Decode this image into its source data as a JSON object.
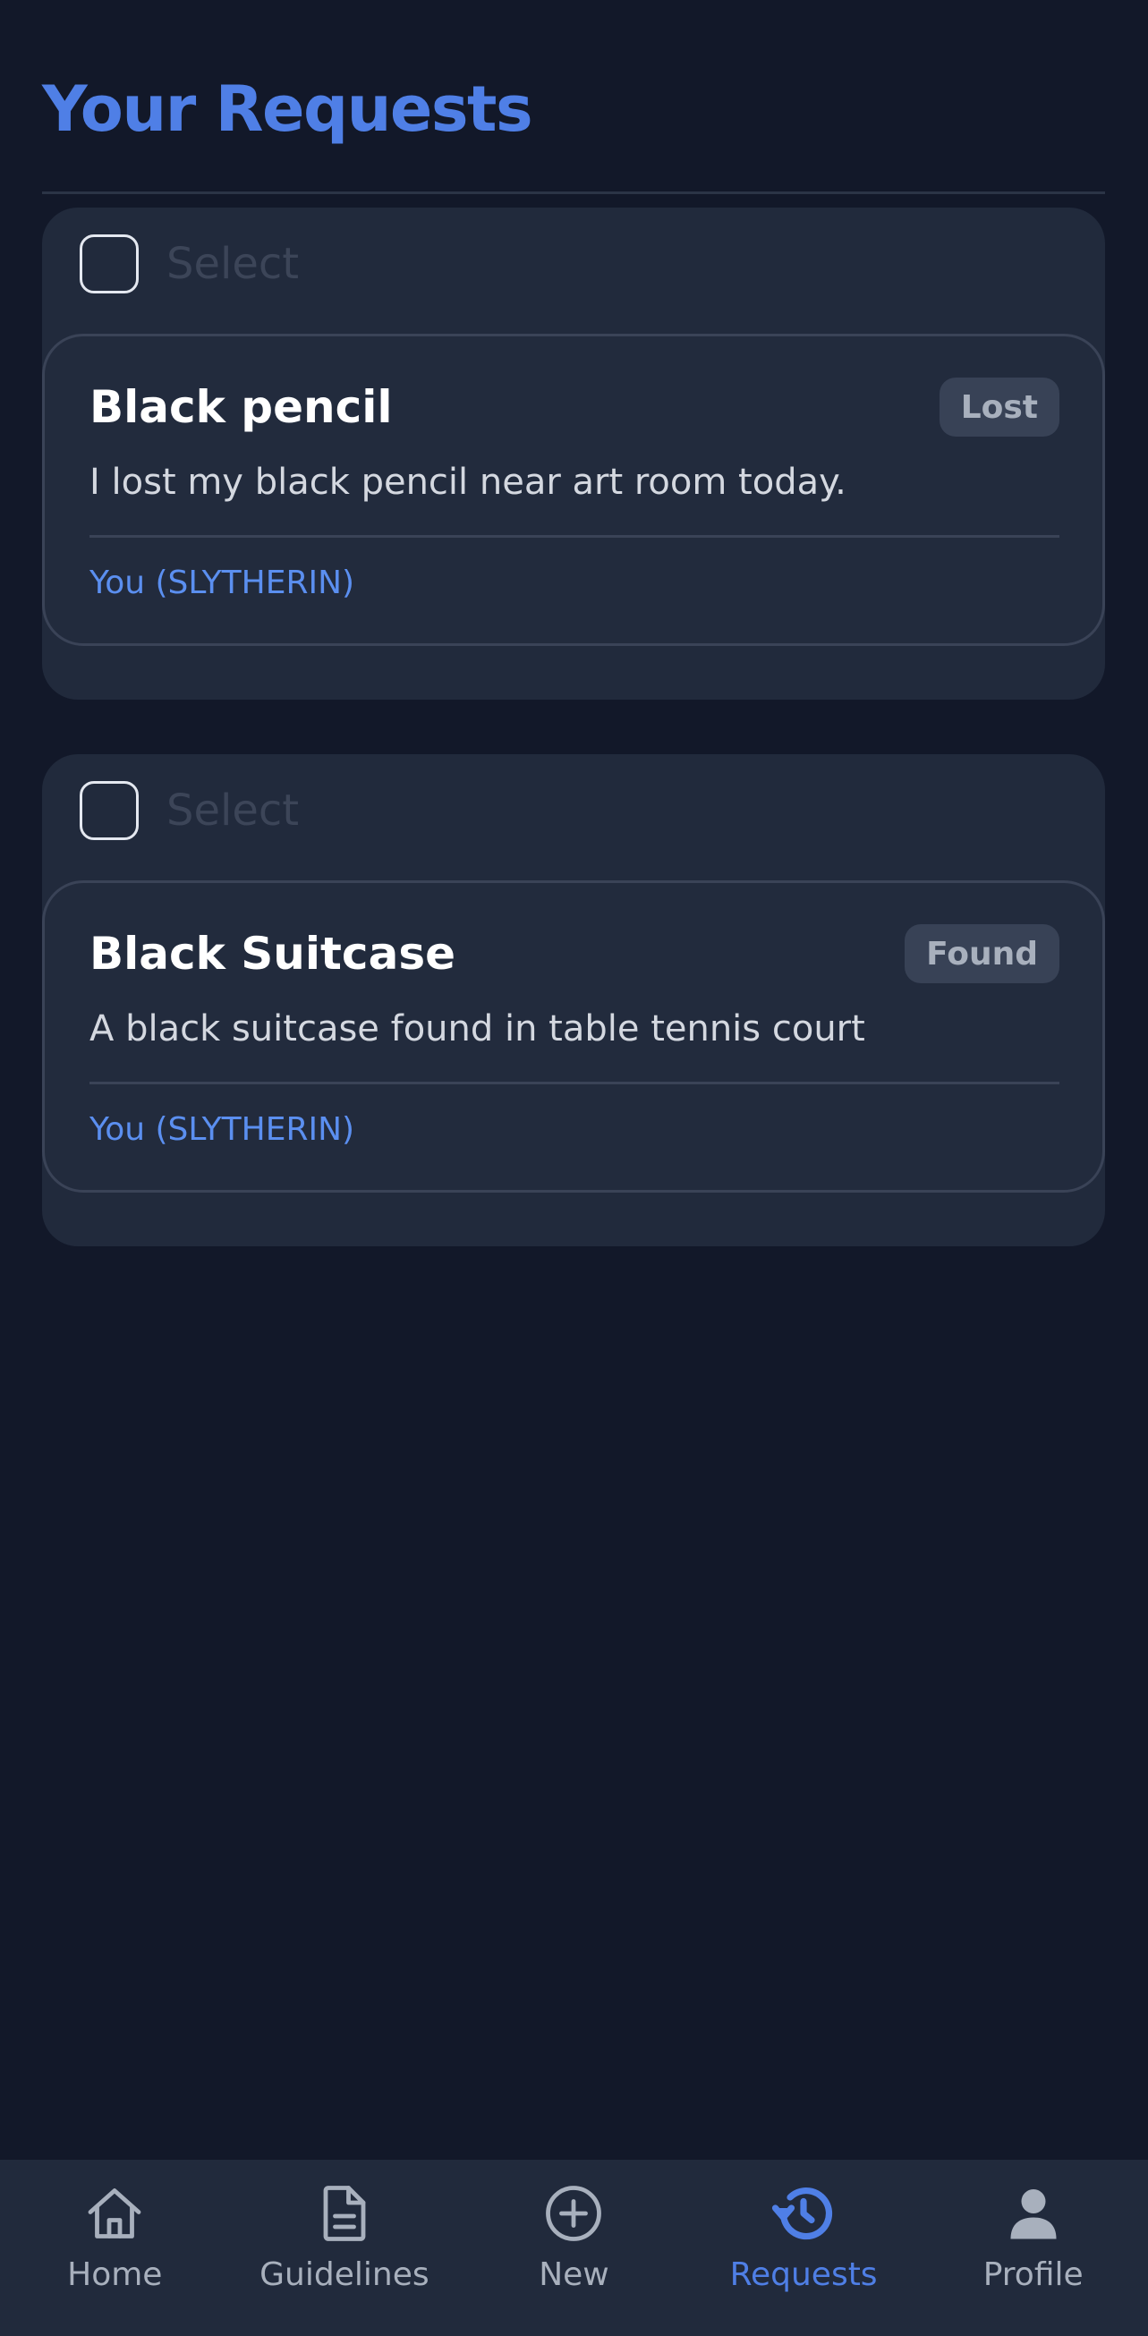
{
  "header": {
    "title": "Your Requests"
  },
  "requests": [
    {
      "select_label": "Select",
      "title": "Black pencil",
      "status": "Lost",
      "description": "I lost my black pencil near art room today.",
      "owner": "You (SLYTHERIN)"
    },
    {
      "select_label": "Select",
      "title": "Black Suitcase",
      "status": "Found",
      "description": "A black suitcase found in table tennis court",
      "owner": "You (SLYTHERIN)"
    }
  ],
  "nav": {
    "items": [
      {
        "label": "Home",
        "icon": "home-icon"
      },
      {
        "label": "Guidelines",
        "icon": "document-icon"
      },
      {
        "label": "New",
        "icon": "plus-circle-icon"
      },
      {
        "label": "Requests",
        "icon": "history-icon",
        "active": true
      },
      {
        "label": "Profile",
        "icon": "person-icon"
      }
    ]
  },
  "colors": {
    "background": "#121829",
    "card": "#212a3c",
    "accent": "#4f7fe6",
    "owner_text": "#5b8ff0",
    "nav_inactive": "#a8b0bd"
  }
}
